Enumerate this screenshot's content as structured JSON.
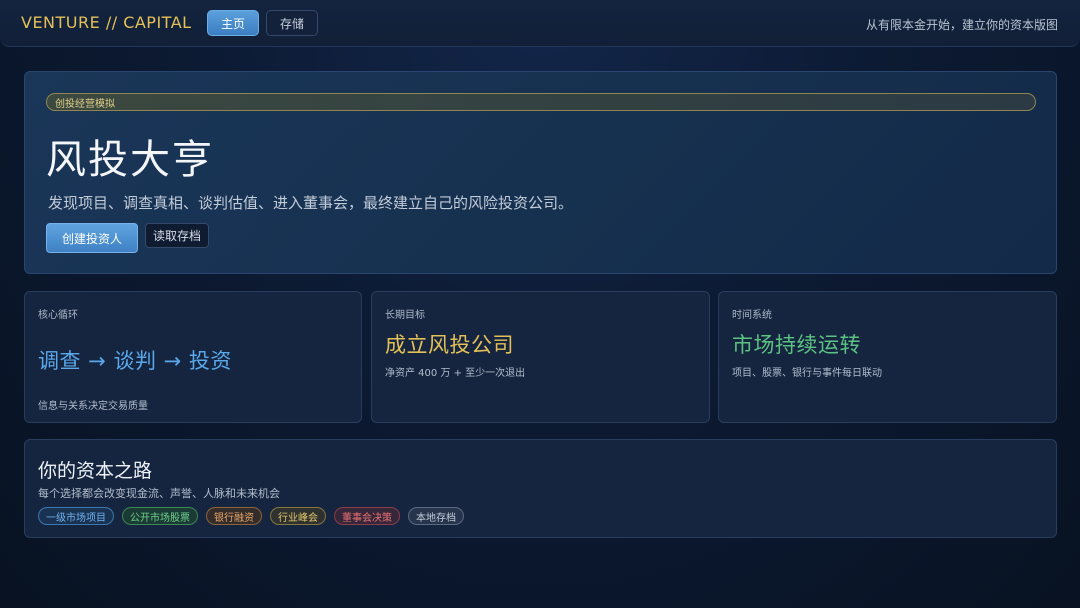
{
  "header": {
    "brand": "VENTURE // CAPITAL",
    "nav_home": "主页",
    "nav_save": "存储",
    "tagline": "从有限本金开始，建立你的资本版图"
  },
  "hero": {
    "badge": "创投经营模拟",
    "title": "风投大亨",
    "description": "发现项目、调查真相、谈判估值、进入董事会，最终建立自己的风险投资公司。",
    "create_button": "创建投资人",
    "load_button": "读取存档"
  },
  "cards": [
    {
      "label": "核心循环",
      "headline": "调查 → 谈判 → 投资",
      "sub": "信息与关系决定交易质量",
      "color": "#5aa8ea"
    },
    {
      "label": "长期目标",
      "headline": "成立风投公司",
      "sub": "净资产 400 万 + 至少一次退出",
      "color": "#e4c057"
    },
    {
      "label": "时间系统",
      "headline": "市场持续运转",
      "sub": "项目、股票、银行与事件每日联动",
      "color": "#5cc281"
    }
  ],
  "roadmap": {
    "title": "你的资本之路",
    "subtitle": "每个选择都会改变现金流、声誉、人脉和未来机会",
    "tags": [
      "一级市场项目",
      "公开市场股票",
      "银行融资",
      "行业峰会",
      "董事会决策",
      "本地存档"
    ]
  }
}
